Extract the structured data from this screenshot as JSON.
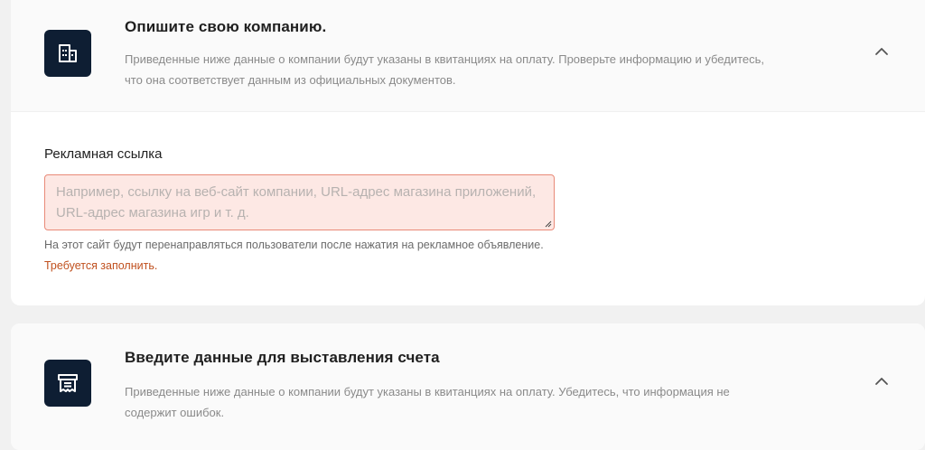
{
  "company_section": {
    "title": "Опишите свою компанию.",
    "description": "Приведенные ниже данные о компании будут указаны в квитанциях на оплату. Проверьте информацию и убедитесь, что она соответствует данным из официальных документов.",
    "icon": "building-icon",
    "expanded": true,
    "field": {
      "label": "Рекламная ссылка",
      "value": "",
      "placeholder": "Например, ссылку на веб-сайт компании, URL-адрес магазина приложений, URL-адрес магазина игр и т. д.",
      "helper": "На этот сайт будут перенаправляться пользователи после нажатия на рекламное объявление.",
      "error": "Требуется заполнить."
    }
  },
  "billing_section": {
    "title": "Введите данные для выставления счета",
    "description": "Приведенные ниже данные о компании будут указаны в квитанциях на оплату. Убедитесь, что информация не содержит ошибок.",
    "icon": "invoice-icon",
    "expanded": true
  },
  "colors": {
    "icon_bg": "#0e1e33",
    "error_border": "#e98a78",
    "error_bg": "#fde8e4",
    "error_text": "#c0501e"
  }
}
